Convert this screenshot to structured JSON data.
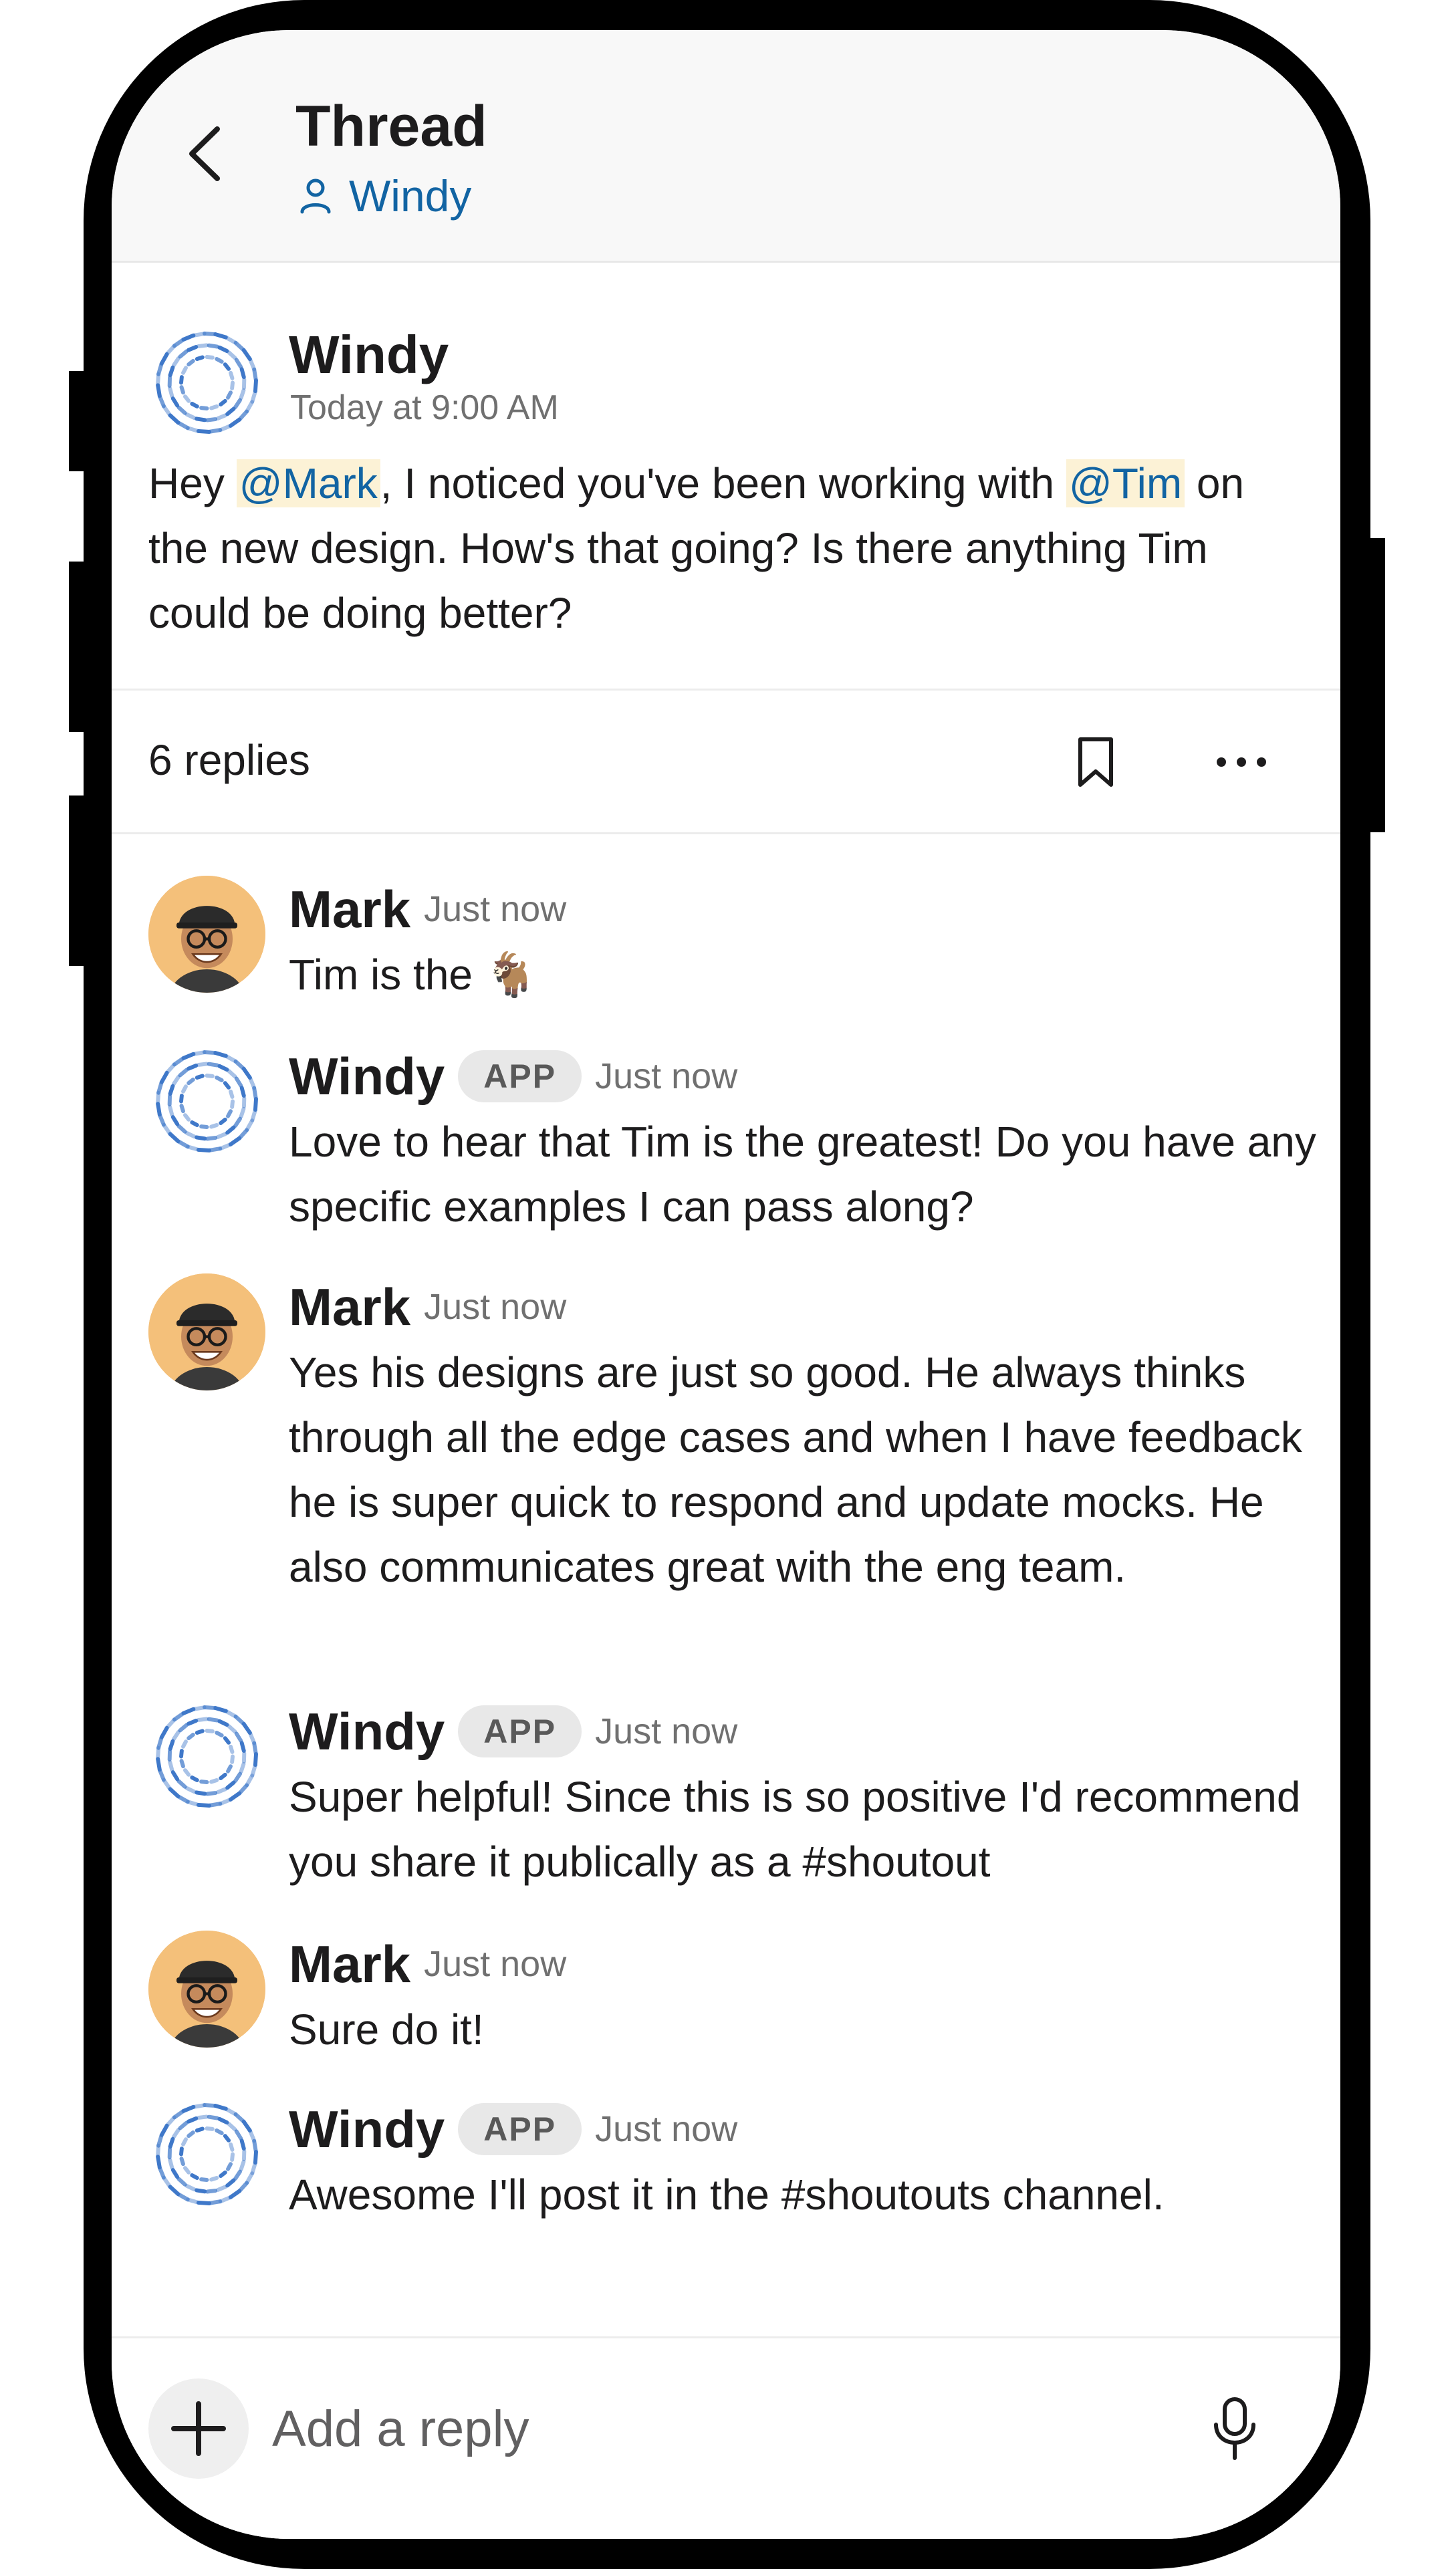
{
  "header": {
    "title": "Thread",
    "subtitle": "Windy",
    "back_icon": "chevron-left-icon",
    "user_icon": "person-icon"
  },
  "parent_message": {
    "author": "Windy",
    "timestamp": "Today at 9:00 AM",
    "text_before": "Hey ",
    "mention_1": "@Mark",
    "text_middle": ", I noticed you've been working with ",
    "mention_2": "@Tim",
    "text_after": " on the new design. How's that going? Is there anything Tim could be doing better?"
  },
  "replies_bar": {
    "count_label": "6 replies",
    "bookmark_icon": "bookmark-icon",
    "more_icon": "more-horizontal-icon"
  },
  "replies": [
    {
      "author": "Mark",
      "badge": "",
      "time": "Just now",
      "text": "Tim is the 🐐"
    },
    {
      "author": "Windy",
      "badge": "APP",
      "time": "Just now",
      "text": "Love to hear that Tim is the greatest! Do you have any specific examples I can pass along?"
    },
    {
      "author": "Mark",
      "badge": "",
      "time": "Just now",
      "text": "Yes his designs are just so good. He always thinks through all the edge cases and when I have feedback he is super quick to respond and update mocks. He also communicates great with the eng team."
    },
    {
      "author": "Windy",
      "badge": "APP",
      "time": "Just now",
      "text": "Super helpful! Since this is so positive I'd recommend you share it publically as a #shoutout"
    },
    {
      "author": "Mark",
      "badge": "",
      "time": "Just now",
      "text": "Sure do it!"
    },
    {
      "author": "Windy",
      "badge": "APP",
      "time": "Just now",
      "text": "Awesome I'll post it in the #shoutouts channel."
    }
  ],
  "composer": {
    "placeholder": "Add a reply",
    "plus_icon": "plus-icon",
    "mic_icon": "microphone-icon"
  },
  "colors": {
    "link": "#1264a3",
    "mention_bg": "#fcf2d6",
    "windy_blue": "#3f78c9",
    "mark_avatar_bg": "#f4c07a"
  }
}
